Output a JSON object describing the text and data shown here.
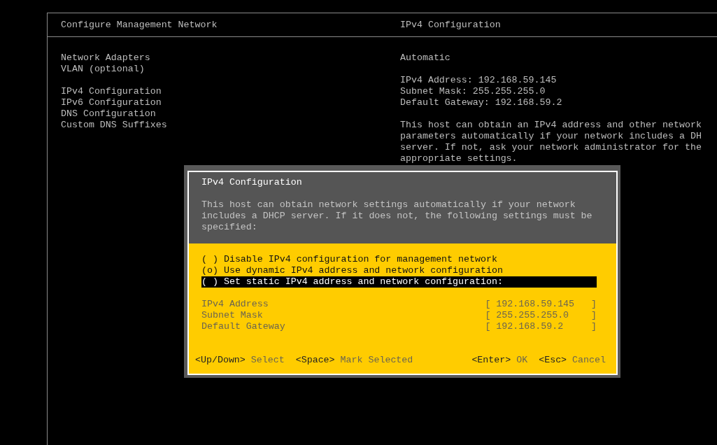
{
  "screen": {
    "title": "Configure Management Network",
    "panel_title": "IPv4 Configuration"
  },
  "menu": [
    {
      "group": [
        {
          "label": "Network Adapters"
        },
        {
          "label": "VLAN (optional)"
        }
      ]
    },
    {
      "group": [
        {
          "label": "IPv4 Configuration"
        },
        {
          "label": "IPv6 Configuration"
        },
        {
          "label": "DNS Configuration"
        },
        {
          "label": "Custom DNS Suffixes"
        }
      ]
    }
  ],
  "details": {
    "mode": "Automatic",
    "values": [
      "IPv4 Address: 192.168.59.145",
      "Subnet Mask: 255.255.255.0",
      "Default Gateway: 192.168.59.2"
    ],
    "description": [
      "This host can obtain an IPv4 address and other network",
      "parameters automatically if your network includes a DH",
      "server. If not, ask your network administrator for the",
      "appropriate settings."
    ]
  },
  "dialog": {
    "title": "IPv4 Configuration",
    "description": "This host can obtain network settings automatically if your network includes a DHCP server. If it does not, the following settings must be specified:",
    "options": [
      {
        "label": "( ) Disable IPv4 configuration for management network",
        "selected": false
      },
      {
        "label": "(o) Use dynamic IPv4 address and network configuration",
        "selected": false
      },
      {
        "label": "( ) Set static IPv4 address and network configuration:",
        "selected": true
      }
    ],
    "fields": [
      {
        "label": "IPv4 Address",
        "value": "[ 192.168.59.145   ]"
      },
      {
        "label": "Subnet Mask",
        "value": "[ 255.255.255.0    ]"
      },
      {
        "label": "Default Gateway",
        "value": "[ 192.168.59.2     ]"
      }
    ],
    "hints_left": [
      {
        "key": "<Up/Down>",
        "action": "Select"
      },
      {
        "key": "<Space>",
        "action": "Mark Selected"
      }
    ],
    "hints_right": [
      {
        "key": "<Enter>",
        "action": "OK"
      },
      {
        "key": "<Esc>",
        "action": "Cancel"
      }
    ]
  }
}
